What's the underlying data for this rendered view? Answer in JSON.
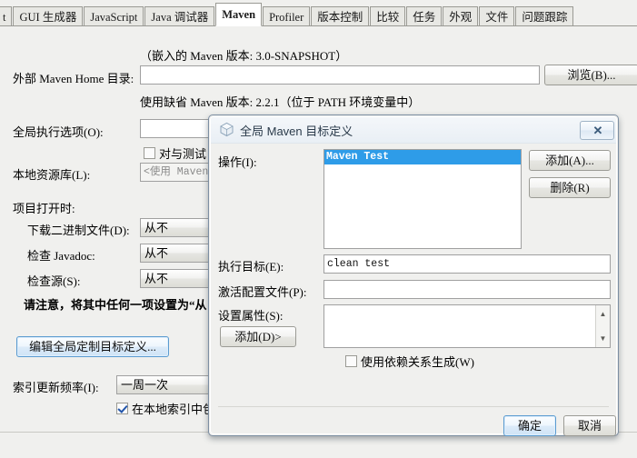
{
  "tabs": [
    {
      "label": "t",
      "selected": false
    },
    {
      "label": "GUI 生成器",
      "selected": false
    },
    {
      "label": "JavaScript",
      "selected": false
    },
    {
      "label": "Java 调试器",
      "selected": false
    },
    {
      "label": "Maven",
      "selected": true
    },
    {
      "label": "Profiler",
      "selected": false
    },
    {
      "label": "版本控制",
      "selected": false
    },
    {
      "label": "比较",
      "selected": false
    },
    {
      "label": "任务",
      "selected": false
    },
    {
      "label": "外观",
      "selected": false
    },
    {
      "label": "文件",
      "selected": false
    },
    {
      "label": "问题跟踪",
      "selected": false
    }
  ],
  "maven_panel": {
    "embedded_version_note": "（嵌入的 Maven 版本: 3.0-SNAPSHOT）",
    "home_label": "外部 Maven Home 目录:",
    "home_value": "",
    "browse_button": "浏览(B)...",
    "default_version_note": "使用缺省 Maven 版本: 2.2.1（位于 PATH 环境变量中）",
    "global_exec_options_label": "全局执行选项(O):",
    "global_exec_options_value": "",
    "skip_tests_checkbox": "对与测试",
    "local_repo_label": "本地资源库(L):",
    "local_repo_value": "<使用 Maven",
    "project_open_label": "项目打开时:",
    "download_binaries_label": "下载二进制文件(D):",
    "download_binaries_value": "从不",
    "check_javadoc_label": "检查 Javadoc:",
    "check_javadoc_value": "从不",
    "check_sources_label": "检查源(S):",
    "check_sources_value": "从不",
    "warning_note": "请注意，将其中任何一项设置为“从",
    "edit_global_goals_button": "编辑全局定制目标定义...",
    "index_freq_label": "索引更新频率(I):",
    "index_freq_value": "一周一次",
    "include_local_checkbox": "在本地索引中包",
    "include_local_checked": true
  },
  "dialog": {
    "title": "全局 Maven 目标定义",
    "close_label": "✕",
    "actions_label": "操作(I):",
    "actions_items": [
      {
        "label": "Maven Test",
        "selected": true
      }
    ],
    "add_button": "添加(A)...",
    "delete_button": "删除(R)",
    "exec_goals_label": "执行目标(E):",
    "exec_goals_value": "clean test",
    "active_profiles_label": "激活配置文件(P):",
    "active_profiles_value": "",
    "set_properties_label": "设置属性(S):",
    "set_properties_value": "",
    "add_property_button": "添加(D)>",
    "use_deps_checkbox": "使用依赖关系生成(W)",
    "use_deps_checked": false,
    "ok_button": "确定",
    "cancel_button": "取消"
  },
  "colors": {
    "selection_blue": "#2e9ce8",
    "accent_border": "#5b9bd0",
    "window_bg": "#f0f0ee"
  }
}
